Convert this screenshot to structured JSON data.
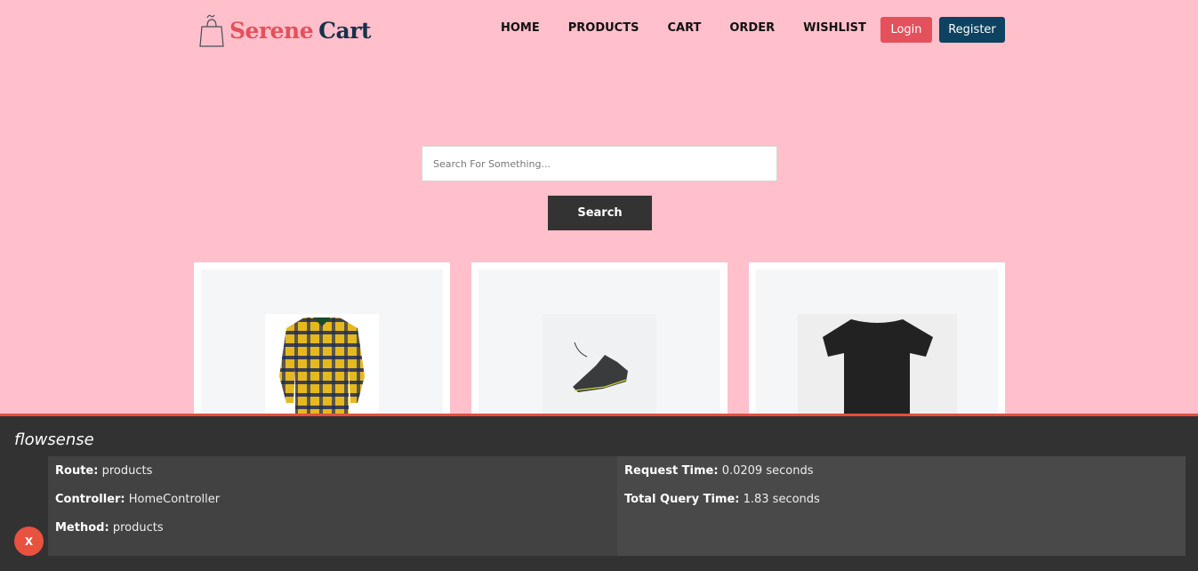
{
  "brand": {
    "part1": "Serene",
    "part2": "Cart",
    "icon": "shopping-bag-icon",
    "color_primary": "#e4505c",
    "color_secondary": "#163249"
  },
  "nav": {
    "items": [
      {
        "label": "HOME"
      },
      {
        "label": "PRODUCTS"
      },
      {
        "label": "CART"
      },
      {
        "label": "ORDER"
      },
      {
        "label": "WISHLIST"
      }
    ],
    "login_label": "Login",
    "register_label": "Register"
  },
  "search": {
    "placeholder": "Search For Something...",
    "value": "",
    "button_label": "Search"
  },
  "products": [
    {
      "image": "plaid-flannel-shirt"
    },
    {
      "image": "black-sneaker"
    },
    {
      "image": "black-tshirt"
    }
  ],
  "debugbar": {
    "title": "flowsense",
    "close_label": "X",
    "accent": "#e4503c",
    "left": [
      {
        "key": "Route:",
        "value": "products"
      },
      {
        "key": "Controller:",
        "value": "HomeController"
      },
      {
        "key": "Method:",
        "value": "products"
      }
    ],
    "right": [
      {
        "key": "Request Time:",
        "value": "0.0209 seconds"
      },
      {
        "key": "Total Query Time:",
        "value": "1.83 seconds"
      }
    ]
  }
}
